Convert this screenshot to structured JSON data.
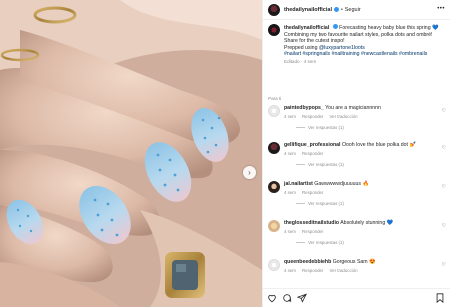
{
  "header": {
    "username": "thedailynailofficial",
    "separator": "•",
    "follow_label": "Seguir",
    "more": "•••"
  },
  "caption": {
    "username": "thedailynailofficial",
    "line1": "Forecasting heavy baby blue this spring",
    "emoji1": "💙",
    "line2": "Combining my two favourite nailart styles, polka dots and ombré!",
    "line3": "Share for the cutest inspo!",
    "prepped_prefix": "Prepped using ",
    "mention": "@luxypartone1loots",
    "tags": "#nailart #springnails #nailtraining #newcastlenails #ombrenails",
    "edited": "Editado · 4 sem"
  },
  "translation_label": "Para ti",
  "comments": [
    {
      "username": "paintedbypops_",
      "text": "You are a magiciannnnn",
      "time": "4 sem",
      "reply": "Responder",
      "translate": "Ver traducción",
      "replies": "Ver respuestas (1)"
    },
    {
      "username": "gellifique_professional",
      "text": "Oooh love the blue polka dot",
      "emoji": "💅",
      "time": "4 sem",
      "reply": "Responder",
      "replies": "Ver respuestas (1)"
    },
    {
      "username": "jal.nailartist",
      "text": "Gawwwwwdjuuuuus",
      "emoji": "🔥",
      "time": "4 sem",
      "reply": "Responder",
      "replies": "Ver respuestas (1)"
    },
    {
      "username": "theglosseditnailstudio",
      "text": "Absolutely stunning",
      "emoji": "💙",
      "time": "4 sem",
      "reply": "Responder",
      "replies": "Ver respuestas (1)"
    },
    {
      "username": "queenbeedebbiehb",
      "text": "Gorgeous Sam",
      "emoji": "😍",
      "time": "4 sem",
      "reply": "Responder",
      "translate": "Ver traducción"
    }
  ],
  "icons": {
    "like": "heart-icon",
    "comment": "comment-icon",
    "share": "share-icon",
    "save": "bookmark-icon",
    "next": "chevron-right-icon"
  },
  "colors": {
    "link": "#00376b",
    "verified": "#3897f0",
    "muted": "#8e8e8e"
  }
}
